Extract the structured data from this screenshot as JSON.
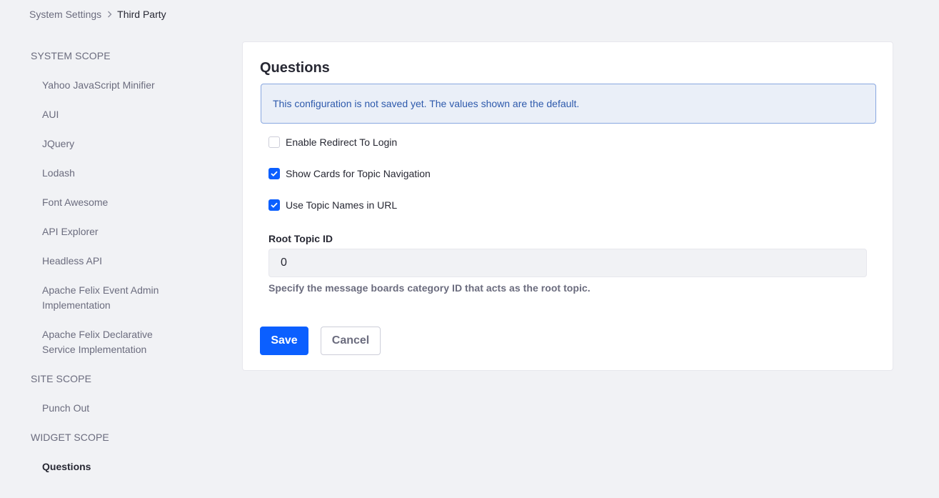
{
  "breadcrumb": {
    "items": [
      "System Settings",
      "Third Party"
    ]
  },
  "sidebar": {
    "sections": [
      {
        "heading": "SYSTEM SCOPE",
        "items": [
          "Yahoo JavaScript Minifier",
          "AUI",
          "JQuery",
          "Lodash",
          "Font Awesome",
          "API Explorer",
          "Headless API",
          "Apache Felix Event Admin Implementation",
          "Apache Felix Declarative Service Implementation"
        ]
      },
      {
        "heading": "SITE SCOPE",
        "items": [
          "Punch Out"
        ]
      },
      {
        "heading": "WIDGET SCOPE",
        "items": [
          "Questions"
        ]
      }
    ],
    "active_item": "Questions"
  },
  "form": {
    "title": "Questions",
    "alert": "This configuration is not saved yet. The values shown are the default.",
    "checkboxes": [
      {
        "label": "Enable Redirect To Login",
        "checked": false
      },
      {
        "label": "Show Cards for Topic Navigation",
        "checked": true
      },
      {
        "label": "Use Topic Names in URL",
        "checked": true
      }
    ],
    "root_topic": {
      "label": "Root Topic ID",
      "value": "0",
      "help": "Specify the message boards category ID that acts as the root topic."
    },
    "save_label": "Save",
    "cancel_label": "Cancel"
  },
  "colors": {
    "primary": "#0b5fff",
    "alert_text": "#2e5aac",
    "alert_bg": "#eaeff8",
    "page_bg": "#f1f2f5"
  }
}
